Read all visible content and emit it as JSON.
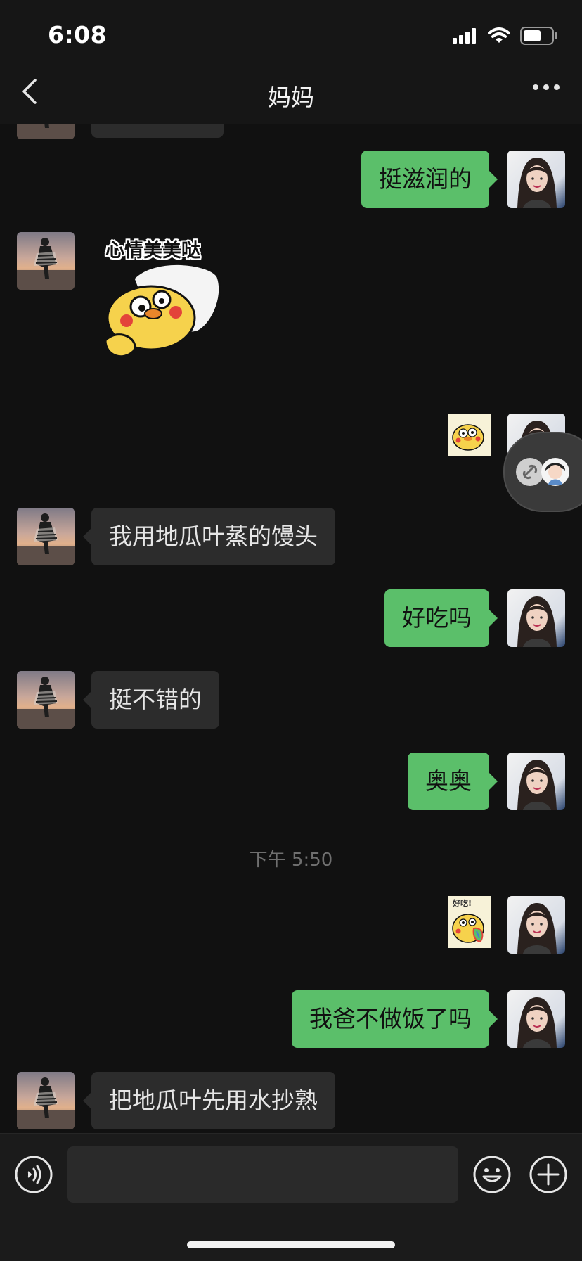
{
  "status_bar": {
    "time": "6:08"
  },
  "nav": {
    "title": "妈妈"
  },
  "messages": {
    "m1": "挺滋润的",
    "m2_sticker_caption": "心情美美哒",
    "m4": "我用地瓜叶蒸的馒头",
    "m5": "好吃吗",
    "m6": "挺不错的",
    "m7": "奥奥",
    "timestamp": "下午 5:50",
    "m8_sticker_caption": "好吃!",
    "m9": "我爸不做饭了吗",
    "m10": "把地瓜叶先用水抄熟"
  },
  "input": {
    "placeholder": ""
  },
  "colors": {
    "background": "#111111",
    "outgoing_bubble": "#5bbf6a",
    "incoming_bubble": "#2c2c2c",
    "bar": "#161616"
  },
  "icons": [
    "signal-icon",
    "wifi-icon",
    "battery-icon",
    "back-icon",
    "more-icon",
    "voice-icon",
    "emoji-icon",
    "plus-icon",
    "link-icon"
  ]
}
